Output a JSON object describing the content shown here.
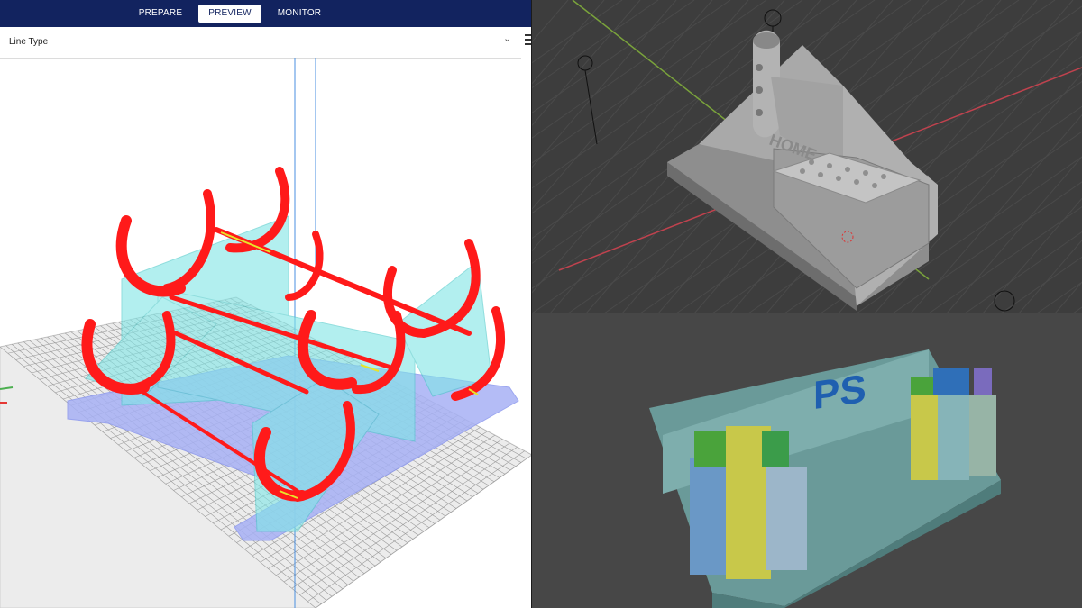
{
  "slicer": {
    "tabs": [
      {
        "label": "PREPARE",
        "active": false
      },
      {
        "label": "PREVIEW",
        "active": true
      },
      {
        "label": "MONITOR",
        "active": false
      }
    ],
    "view_type_label": "Line Type",
    "icons": {
      "dropdown": "chevron-down-icon",
      "menu": "menu-icon"
    },
    "colors": {
      "header": "#12235f",
      "shell": "#ff1a1a",
      "support": "#7fe6e6",
      "build_plate": "#e6e6e6",
      "grid": "#9a9a9a",
      "skirt": "#9aa6f0"
    }
  },
  "blender": {
    "model_text": "HOME",
    "colors": {
      "background": "#3d3d3d",
      "model": "#a7a7a7",
      "x_axis": "#c0424e",
      "y_axis": "#7aa33b"
    }
  },
  "render": {
    "logo_text": "PS",
    "colors": {
      "background": "#474747",
      "base": "#6a9a99",
      "logo": "#1f5fb0"
    }
  }
}
